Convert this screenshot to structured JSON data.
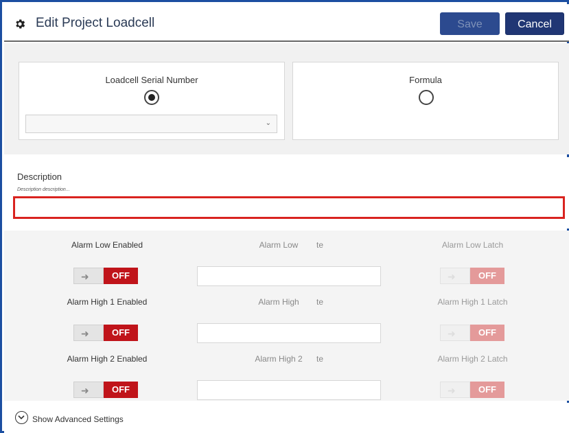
{
  "header": {
    "title": "Edit Project Loadcell",
    "save_label": "Save",
    "cancel_label": "Cancel",
    "icon": "gear-icon"
  },
  "source": {
    "serial_label": "Loadcell Serial Number",
    "serial_selected": true,
    "formula_label": "Formula",
    "formula_selected": false,
    "serial_select_value": ""
  },
  "description": {
    "label": "Description",
    "hint": "Description description...",
    "value": ""
  },
  "alarms": [
    {
      "enabled_label": "Alarm Low Enabled",
      "value_label": "Alarm Low",
      "value_suffix": "te",
      "latch_label": "Alarm Low Latch",
      "toggle_label": "OFF",
      "latch_toggle_label": "OFF",
      "value": ""
    },
    {
      "enabled_label": "Alarm High 1 Enabled",
      "value_label": "Alarm High",
      "value_suffix": "te",
      "latch_label": "Alarm High 1 Latch",
      "toggle_label": "OFF",
      "latch_toggle_label": "OFF",
      "value": ""
    },
    {
      "enabled_label": "Alarm High 2 Enabled",
      "value_label": "Alarm High 2",
      "value_suffix": "te",
      "latch_label": "Alarm High 2 Latch",
      "toggle_label": "OFF",
      "latch_toggle_label": "OFF",
      "value": ""
    }
  ],
  "footer": {
    "advanced_label": "Show Advanced Settings",
    "icon": "chevron-down-circle-icon"
  },
  "colors": {
    "frame": "#1c4fa1",
    "primary_button": "#203674",
    "toggle_off": "#c0141a",
    "toggle_off_disabled": "#e49a9a",
    "highlight_border": "#d9231f"
  }
}
